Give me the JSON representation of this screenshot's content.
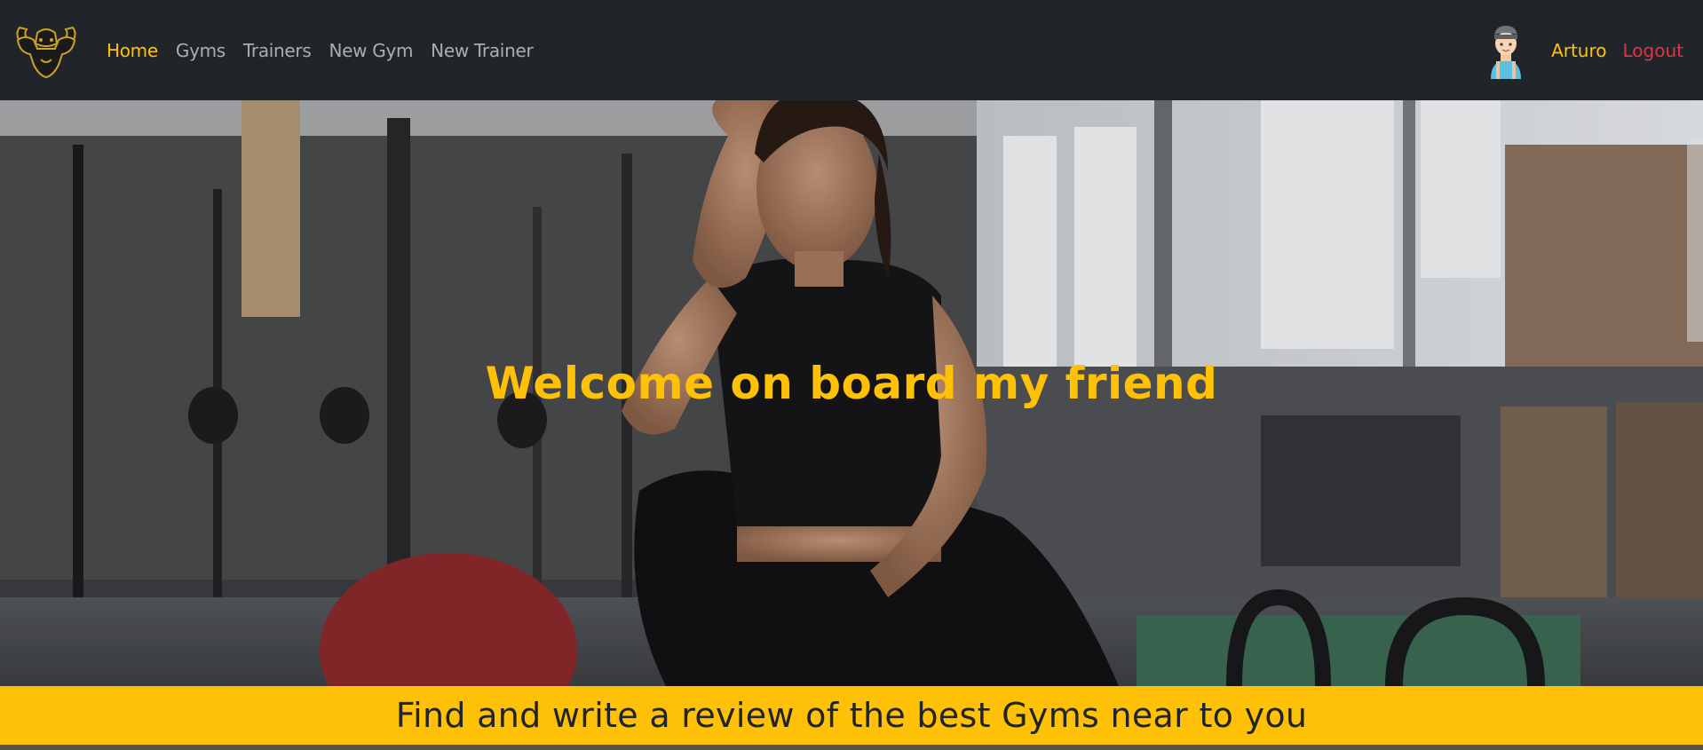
{
  "nav": {
    "logo_icon": "muscular-bull-logo",
    "links": [
      {
        "label": "Home",
        "active": true
      },
      {
        "label": "Gyms",
        "active": false
      },
      {
        "label": "Trainers",
        "active": false
      },
      {
        "label": "New Gym",
        "active": false
      },
      {
        "label": "New Trainer",
        "active": false
      }
    ],
    "user": {
      "avatar_icon": "user-avatar",
      "name": "Arturo",
      "logout_label": "Logout"
    }
  },
  "hero": {
    "image": "woman-sitting-in-gym-photo",
    "title": "Welcome on board my friend"
  },
  "banner": {
    "text": "Find and write a review of the best Gyms near to you"
  },
  "colors": {
    "accent": "#ffc107",
    "navbar_bg": "#212529",
    "logout": "#dc3545",
    "nav_link": "#9a9da0"
  }
}
